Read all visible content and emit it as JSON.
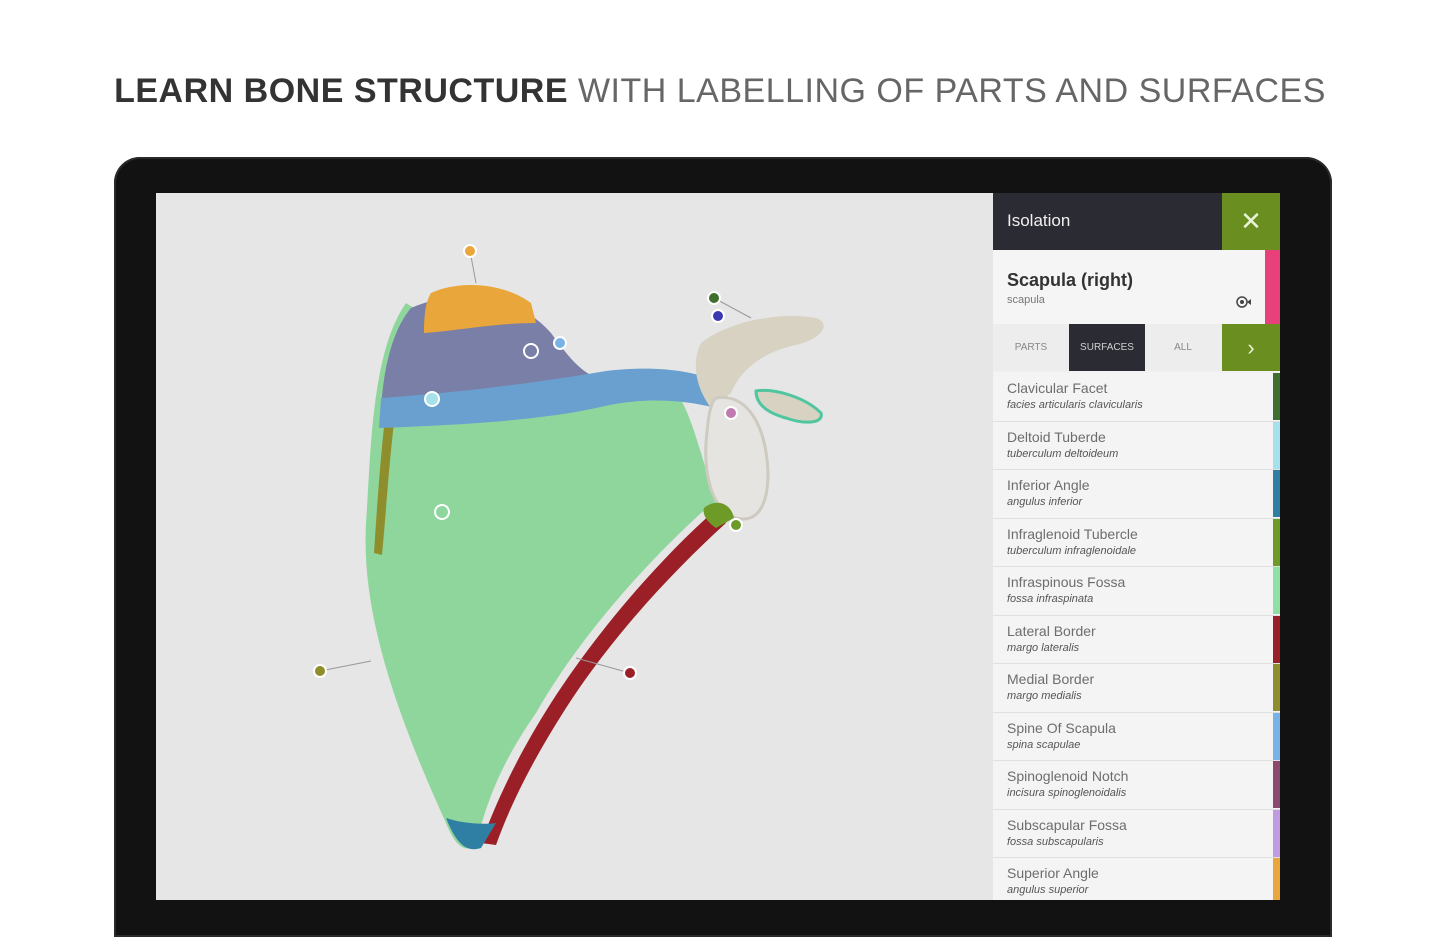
{
  "headline": {
    "bold": "LEARN BONE STRUCTURE",
    "light": " WITH LABELLING OF PARTS AND SURFACES"
  },
  "panel": {
    "title": "Isolation",
    "close_icon": "close-icon",
    "bone": {
      "name": "Scapula (right)",
      "latin": "scapula",
      "accent_color": "#e8407a",
      "visibility_icon": "eye-icon"
    },
    "tabs": [
      {
        "label": "PARTS",
        "active": false
      },
      {
        "label": "SURFACES",
        "active": true
      },
      {
        "label": "ALL",
        "active": false
      }
    ],
    "next_icon": "chevron-right-icon",
    "surfaces": [
      {
        "name": "Clavicular Facet",
        "latin": "facies articularis clavicularis",
        "color": "#3f6f2e"
      },
      {
        "name": "Deltoid Tuberde",
        "latin": "tuberculum deltoideum",
        "color": "#a6e0ea"
      },
      {
        "name": "Inferior Angle",
        "latin": "angulus inferior",
        "color": "#2e7fa3"
      },
      {
        "name": "Infraglenoid Tubercle",
        "latin": "tuberculum infraglenoidale",
        "color": "#6e9a28"
      },
      {
        "name": "Infraspinous Fossa",
        "latin": "fossa infraspinata",
        "color": "#8fe0a3"
      },
      {
        "name": "Lateral Border",
        "latin": "margo lateralis",
        "color": "#9b1f26"
      },
      {
        "name": "Medial Border",
        "latin": "margo medialis",
        "color": "#8e8e2c"
      },
      {
        "name": "Spine Of Scapula",
        "latin": "spina scapulae",
        "color": "#79b3e6"
      },
      {
        "name": "Spinoglenoid Notch",
        "latin": "incisura spinoglenoidalis",
        "color": "#8a4a6e"
      },
      {
        "name": "Subscapular Fossa",
        "latin": "fossa subscapularis",
        "color": "#c09be0"
      },
      {
        "name": "Superior Angle",
        "latin": "angulus superior",
        "color": "#e9a63a"
      }
    ]
  },
  "viewer": {
    "model": "scapula-3d-model",
    "colors": {
      "infraspinous": "#8fd69c",
      "supraspinous": "#7a7fa8",
      "superior_angle": "#e9a63a",
      "lateral_border": "#9b1f26",
      "spine": "#6aa0cf",
      "bone": "#d8d2c2",
      "inferior_angle": "#2e7fa3",
      "medial_border": "#8e8e2c"
    }
  }
}
